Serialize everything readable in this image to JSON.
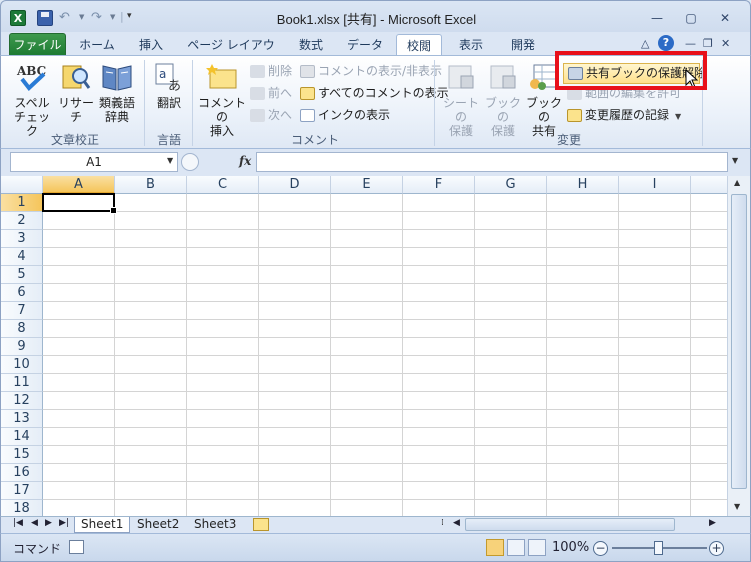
{
  "titlebar": {
    "title": "Book1.xlsx  [共有] - Microsoft Excel",
    "app_icon_letter": "X"
  },
  "tabs": [
    "ファイル",
    "ホーム",
    "挿入",
    "ページ レイアウト",
    "数式",
    "データ",
    "校閲",
    "表示",
    "開発"
  ],
  "active_tab": "校閲",
  "ribbon": {
    "proofing": {
      "spelling_line1": "スペル",
      "spelling_line2": "チェック",
      "research": "リサーチ",
      "thesaurus_line1": "類義語",
      "thesaurus_line2": "辞典",
      "label": "文章校正"
    },
    "language": {
      "translate": "翻訳",
      "label": "言語"
    },
    "comments": {
      "new_line1": "コメントの",
      "new_line2": "挿入",
      "delete": "削除",
      "previous": "前へ",
      "next": "次へ",
      "show_hide": "コメントの表示/非表示",
      "show_all": "すべてのコメントの表示",
      "show_ink": "インクの表示",
      "label": "コメント"
    },
    "changes": {
      "protect_sheet_line1": "シートの",
      "protect_sheet_line2": "保護",
      "protect_workbook_line1": "ブックの",
      "protect_workbook_line2": "保護",
      "share_workbook_line1": "ブックの",
      "share_workbook_line2": "共有",
      "unprotect_shared": "共有ブックの保護解除",
      "allow_edit_ranges": "範囲の編集を許可",
      "track_changes": "変更履歴の記録",
      "label": "変更"
    }
  },
  "formula_bar": {
    "name_box": "A1",
    "fx": "fx",
    "value": ""
  },
  "grid": {
    "columns": [
      "A",
      "B",
      "C",
      "D",
      "E",
      "F",
      "G",
      "H",
      "I"
    ],
    "rows": [
      "1",
      "2",
      "3",
      "4",
      "5",
      "6",
      "7",
      "8",
      "9",
      "10",
      "11",
      "12",
      "13",
      "14",
      "15",
      "16",
      "17",
      "18"
    ],
    "active_cell": "A1"
  },
  "sheets": [
    "Sheet1",
    "Sheet2",
    "Sheet3"
  ],
  "statusbar": {
    "mode": "コマンド",
    "zoom": "100%"
  }
}
